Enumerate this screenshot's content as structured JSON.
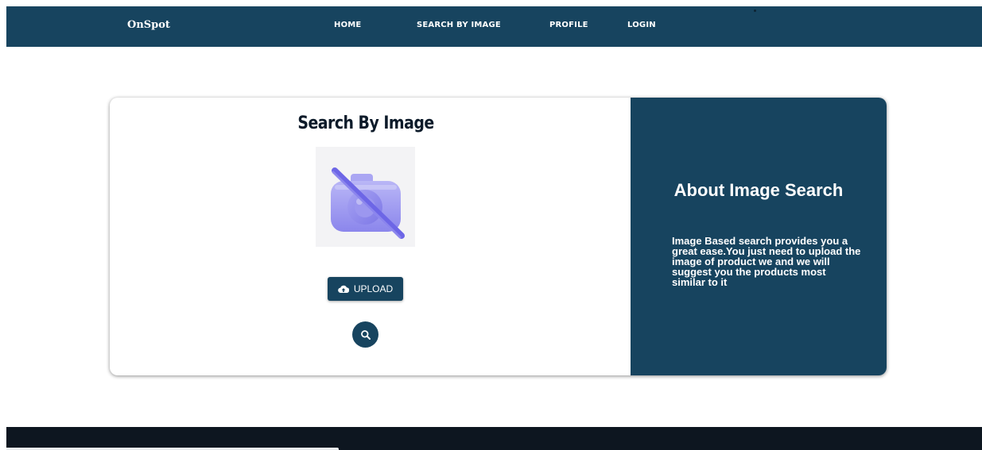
{
  "nav": {
    "brand": "OnSpot",
    "links": [
      {
        "label": "HOME"
      },
      {
        "label": "SEARCH BY IMAGE"
      },
      {
        "label": "PROFILE"
      },
      {
        "label": "LOGIN"
      }
    ],
    "bg_color": "#17445f"
  },
  "search_card": {
    "title": "Search By Image",
    "preview_icon": "camera-off-icon",
    "upload_label": "UPLOAD",
    "upload_icon": "cloud-upload-icon",
    "search_icon": "search-icon"
  },
  "about": {
    "title": "About Image Search",
    "text": "Image Based search provides you a great ease.You just need to upload the image of product we and we will suggest you the products most similar to it"
  },
  "colors": {
    "primary": "#17445f",
    "footer": "#0d1620",
    "preview_accent": "#8b86ec"
  }
}
